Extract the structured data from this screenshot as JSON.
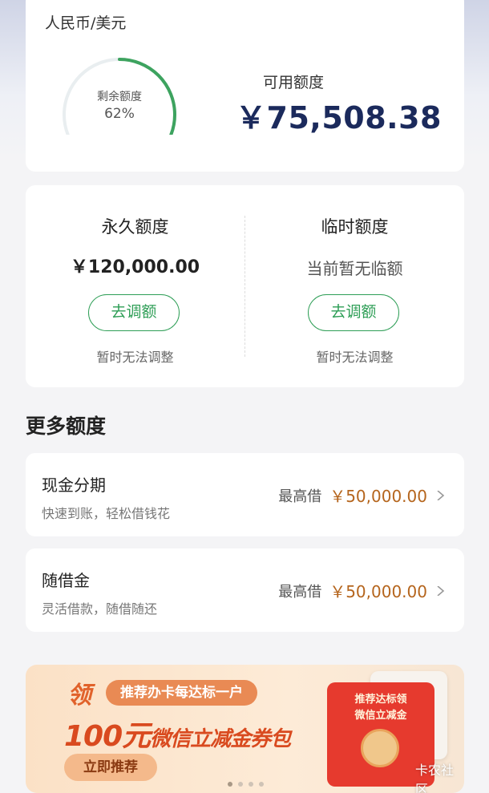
{
  "top_card": {
    "currency": "人民币/美元",
    "gauge_label": "剩余额度",
    "gauge_percent": "62%",
    "gauge_fraction": 0.62,
    "available_label": "可用额度",
    "available_amount": "￥75,508.38"
  },
  "limits": {
    "permanent": {
      "title": "永久额度",
      "value": "￥120,000.00",
      "button": "去调额",
      "note": "暂时无法调整"
    },
    "temporary": {
      "title": "临时额度",
      "value": "当前暂无临额",
      "button": "去调额",
      "note": "暂时无法调整"
    }
  },
  "more_section": {
    "title": "更多额度",
    "items": [
      {
        "title": "现金分期",
        "subtitle": "快速到账，轻松借钱花",
        "max_label": "最高借",
        "amount": "￥50,000.00"
      },
      {
        "title": "随借金",
        "subtitle": "灵活借款，随借随还",
        "max_label": "最高借",
        "amount": "￥50,000.00"
      }
    ]
  },
  "banner": {
    "ling": "领",
    "tag": "推荐办卡每达标一户",
    "headline_big": "100元",
    "headline_small": "微信立减金券包",
    "cta": "立即推荐",
    "envelope_line1": "推荐达标领",
    "envelope_line2": "微信立减金",
    "watermark": "卡农社区"
  },
  "colors": {
    "accent_green": "#2e9e56",
    "amount_orange": "#b5651d",
    "navy": "#1b2a5c"
  }
}
